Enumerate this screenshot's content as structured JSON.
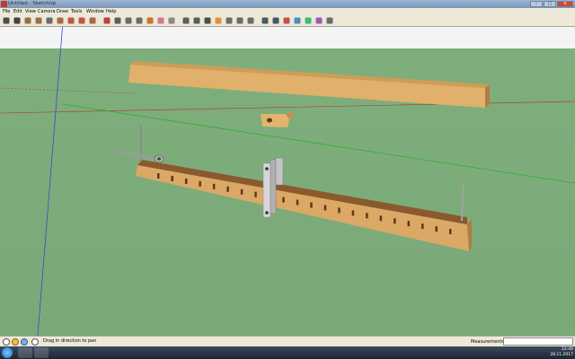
{
  "window": {
    "title": "Untitled - SketchUp"
  },
  "menu": [
    "File",
    "Edit",
    "View",
    "Camera",
    "Draw",
    "Tools",
    "Window",
    "Help"
  ],
  "toolbar": [
    "select-icon",
    "line-icon",
    "rectangle-icon",
    "circle-icon",
    "arc-icon",
    "push-pull-icon",
    "move-icon",
    "rotate-icon",
    "offset-icon",
    "orbit-icon",
    "pan-icon",
    "zoom-icon",
    "zoom-extents-icon",
    "paint-bucket-icon",
    "eraser-icon",
    "tape-measure-icon",
    "text-icon",
    "dimension-icon",
    "axes-icon",
    "section-plane-icon",
    "walk-icon",
    "look-around-icon",
    "position-camera-icon",
    "get-models-icon",
    "share-model-icon",
    "extension-warehouse-icon",
    "layout-icon",
    "add-location-icon",
    "photo-texture-icon",
    "model-info-icon"
  ],
  "status": {
    "hint": "Drag in direction to pan",
    "measurements_label": "Measurements",
    "measurements_value": ""
  },
  "taskbar": {
    "time": "22:49",
    "date": "28.11.2017"
  },
  "colors": {
    "ground": "#7aa978",
    "sky": "#f3f4f4",
    "wood_front": "#d9a862",
    "wood_top": "#b8844b",
    "wood_dark": "#8a5a2e"
  }
}
